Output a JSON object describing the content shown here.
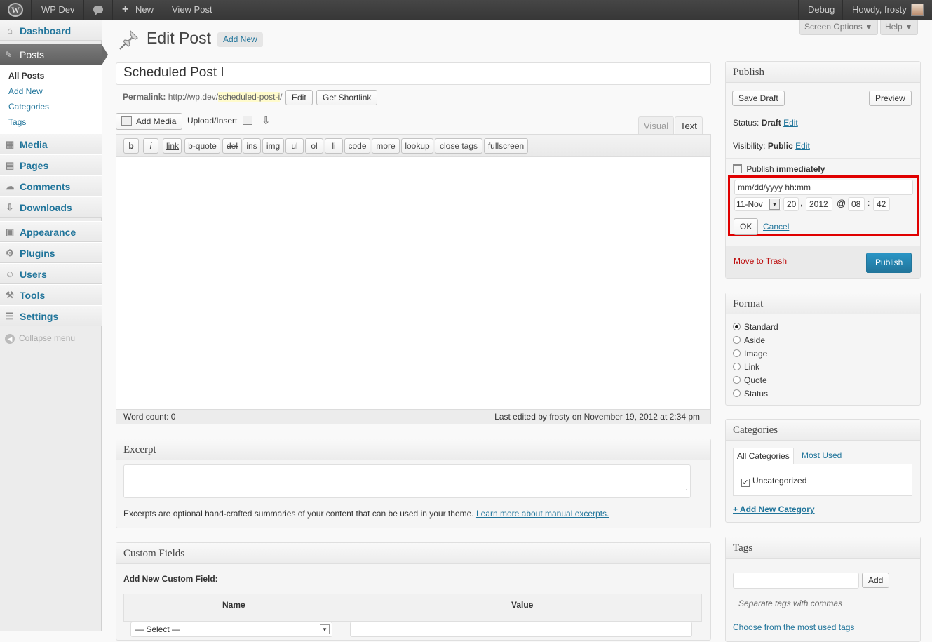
{
  "adminbar": {
    "site_name": "WP Dev",
    "new_label": "New",
    "new_glyph": "+",
    "view_post": "View Post",
    "debug": "Debug",
    "howdy": "Howdy, frosty",
    "logo_glyph": "W"
  },
  "sidebar": {
    "dashboard": "Dashboard",
    "posts": "Posts",
    "submenu": [
      "All Posts",
      "Add New",
      "Categories",
      "Tags"
    ],
    "media": "Media",
    "pages": "Pages",
    "comments": "Comments",
    "downloads": "Downloads",
    "appearance": "Appearance",
    "plugins": "Plugins",
    "users": "Users",
    "tools": "Tools",
    "settings": "Settings",
    "collapse": "Collapse menu",
    "collapse_glyph": "◀",
    "icon_glyphs": {
      "dashboard": "⌂",
      "posts": "✎",
      "media": "▦",
      "pages": "▤",
      "comments": "☁",
      "downloads": "⇩",
      "appearance": "▣",
      "plugins": "⚙",
      "users": "☺",
      "tools": "⚒",
      "settings": "☰"
    }
  },
  "header": {
    "title": "Edit Post",
    "add_new": "Add New",
    "screen_options": "Screen Options ▼",
    "help": "Help ▼"
  },
  "post": {
    "title": "Scheduled Post I",
    "permalink_label": "Permalink:",
    "permalink_base": "http://wp.dev/",
    "permalink_slug": "scheduled-post-i",
    "permalink_end": "/",
    "edit_btn": "Edit",
    "shortlink_btn": "Get Shortlink"
  },
  "editor": {
    "add_media": "Add Media",
    "upload_insert": "Upload/Insert",
    "tab_visual": "Visual",
    "tab_text": "Text",
    "quicktags": [
      "b",
      "i",
      "link",
      "b-quote",
      "del",
      "ins",
      "img",
      "ul",
      "ol",
      "li",
      "code",
      "more",
      "lookup",
      "close tags",
      "fullscreen"
    ],
    "content": "",
    "word_count": "Word count: 0",
    "last_edited": "Last edited by frosty on November 19, 2012 at 2:34 pm"
  },
  "excerpt": {
    "title": "Excerpt",
    "value": "",
    "help": "Excerpts are optional hand-crafted summaries of your content that can be used in your theme.",
    "learn_more": "Learn more about manual excerpts."
  },
  "custom_fields": {
    "title": "Custom Fields",
    "add_new_label": "Add New Custom Field:",
    "col_name": "Name",
    "col_value": "Value",
    "select_value": "— Select —"
  },
  "publish": {
    "title": "Publish",
    "save_draft": "Save Draft",
    "preview": "Preview",
    "status_label": "Status:",
    "status_value": "Draft",
    "visibility_label": "Visibility:",
    "visibility_value": "Public",
    "edit_link": "Edit",
    "publish_label": "Publish",
    "publish_value": "immediately",
    "date_placeholder": "mm/dd/yyyy hh:mm",
    "month": "11-Nov",
    "day": "20",
    "year": "2012",
    "hour": "08",
    "minute": "42",
    "comma": ",",
    "at": "@",
    "colon": ":",
    "ok": "OK",
    "cancel": "Cancel",
    "trash": "Move to Trash",
    "publish_btn": "Publish",
    "highlight_color": "#e00000"
  },
  "format": {
    "title": "Format",
    "options": [
      "Standard",
      "Aside",
      "Image",
      "Link",
      "Quote",
      "Status"
    ],
    "selected": "Standard"
  },
  "categories": {
    "title": "Categories",
    "tab_all": "All Categories",
    "tab_most_used": "Most Used",
    "items": [
      "Uncategorized"
    ],
    "add_new": "+ Add New Category"
  },
  "tags": {
    "title": "Tags",
    "input_value": "",
    "add_btn": "Add",
    "hint": "Separate tags with commas",
    "choose": "Choose from the most used tags"
  }
}
